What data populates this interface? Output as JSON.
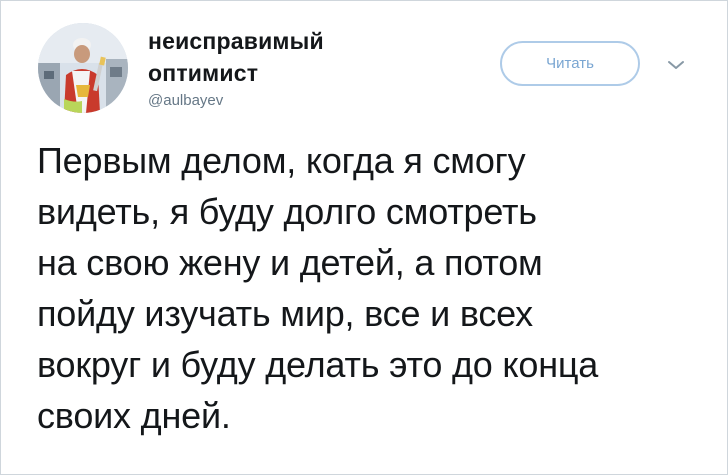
{
  "author": {
    "display_name": "неисправимый оптимист",
    "handle": "@aulbayev"
  },
  "actions": {
    "follow_label": "Читать"
  },
  "icons": {
    "more": "chevron-down-icon"
  },
  "tweet": {
    "text": "Первым делом, когда я смогу\nвидеть, я буду долго смотреть\nна свою жену и детей, а потом\nпойду изучать мир, все и всех\nвокруг и буду делать это до конца\nсвоих дней."
  },
  "colors": {
    "text": "#14171a",
    "muted": "#657786",
    "button_border": "#aecbe8",
    "button_text": "#7aa6d2",
    "card_border": "#cfd6dc"
  }
}
